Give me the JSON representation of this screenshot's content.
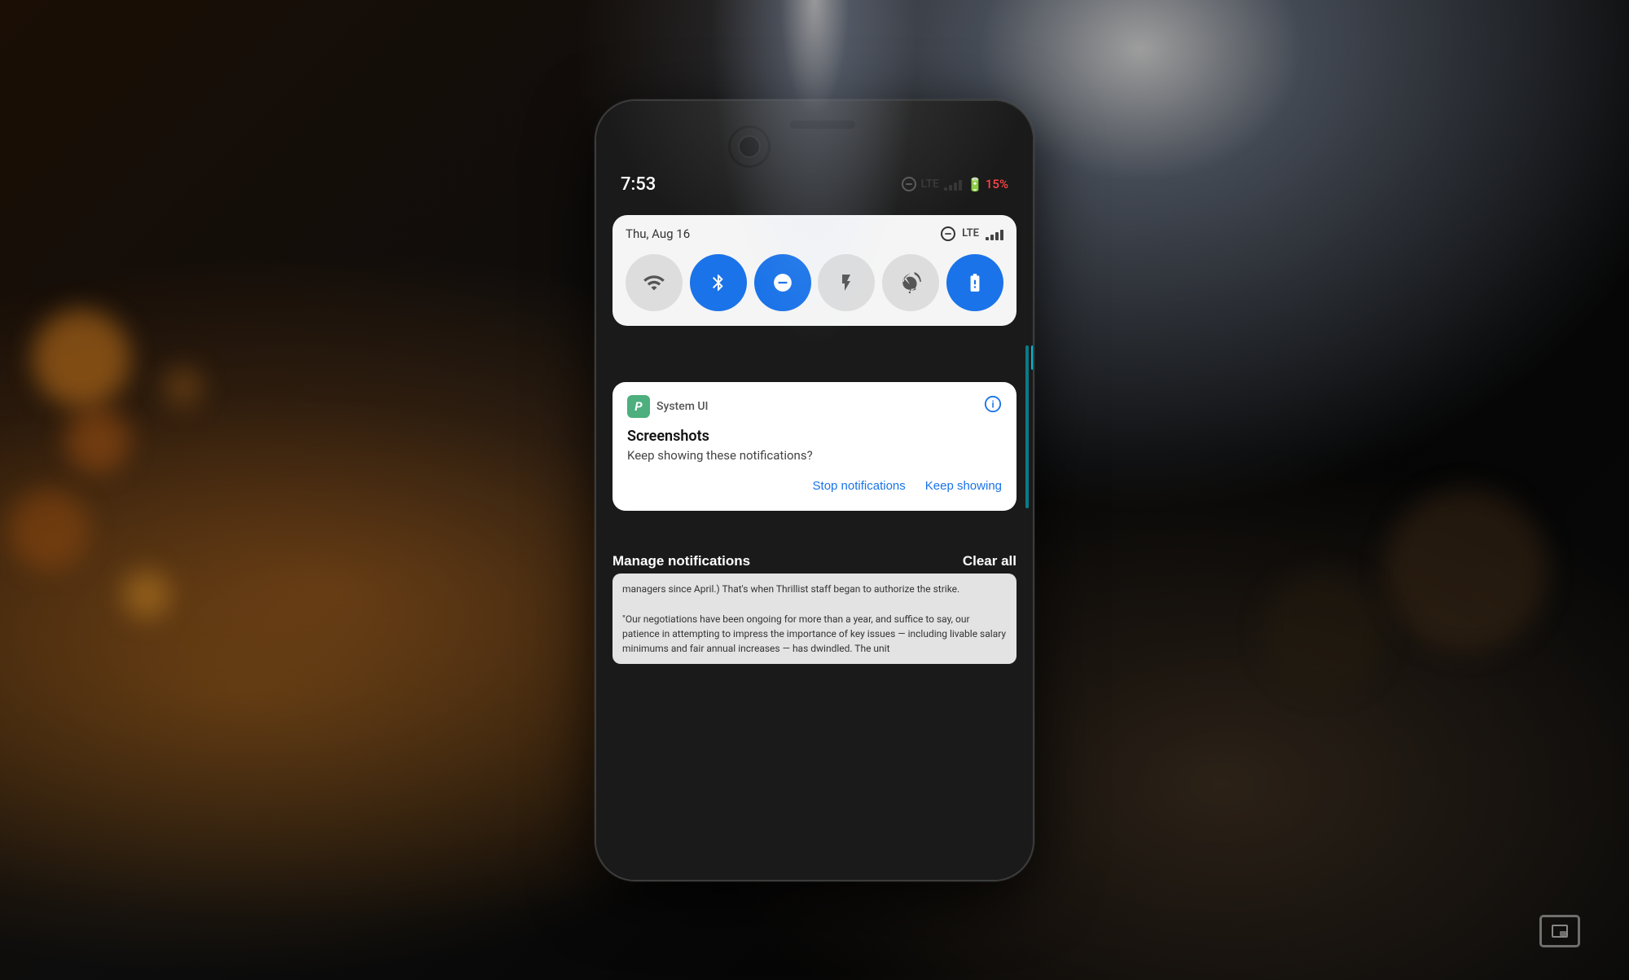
{
  "background": {
    "description": "Dark bokeh background with light source at top center"
  },
  "phone": {
    "statusBar": {
      "time": "7:53",
      "battery": "15%",
      "batteryColor": "#ff4444",
      "date": "Thu, Aug 16",
      "networkType": "LTE"
    },
    "quickSettings": {
      "tiles": [
        {
          "name": "wifi",
          "label": "Wi-Fi",
          "active": false,
          "icon": "wifi"
        },
        {
          "name": "bluetooth",
          "label": "Bluetooth",
          "active": true,
          "icon": "bluetooth"
        },
        {
          "name": "dnd",
          "label": "Do Not Disturb",
          "active": true,
          "icon": "dnd"
        },
        {
          "name": "flashlight",
          "label": "Flashlight",
          "active": false,
          "icon": "flashlight"
        },
        {
          "name": "rotate",
          "label": "Auto-rotate",
          "active": false,
          "icon": "rotate"
        },
        {
          "name": "battery-saver",
          "label": "Battery Saver",
          "active": true,
          "icon": "battery"
        }
      ]
    },
    "notification": {
      "appIcon": "🅟",
      "appName": "System UI",
      "title": "Screenshots",
      "body": "Keep showing these notifications?",
      "stopLabel": "Stop notifications",
      "keepLabel": "Keep showing"
    },
    "bottomBar": {
      "manageLabel": "Manage notifications",
      "clearLabel": "Clear all"
    },
    "articleText": "managers since April.) That's when Thrillist staff began to authorize the strike.\n\n\"Our negotiations have been ongoing for more than a year, and suffice to say, our patience in attempting to impress the importance of key issues — including livable salary minimums and fair annual increases — has dwindled. The unit"
  }
}
